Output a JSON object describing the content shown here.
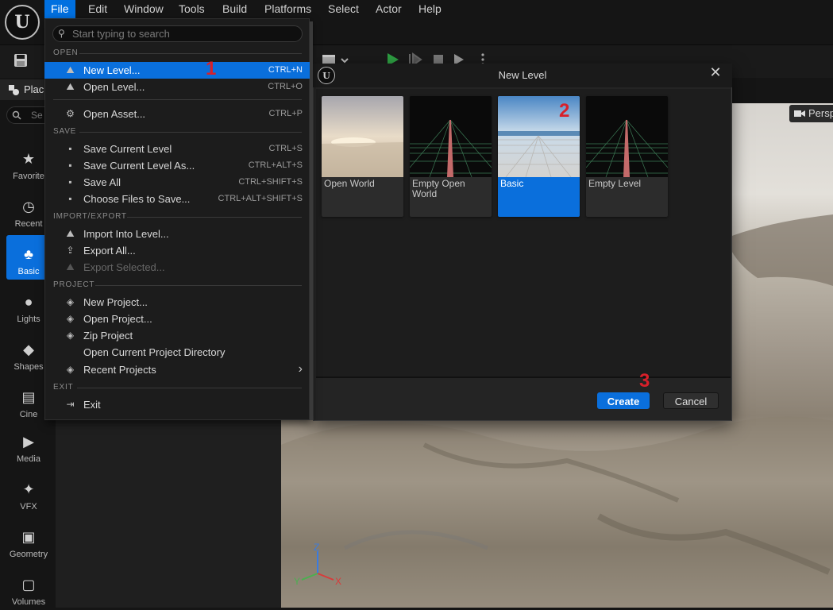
{
  "menubar": {
    "items": [
      "File",
      "Edit",
      "Window",
      "Tools",
      "Build",
      "Platforms",
      "Select",
      "Actor",
      "Help"
    ]
  },
  "place_panel": {
    "tab_label": "Plac",
    "search_placeholder": "Se",
    "modes": [
      {
        "label": "Favorite",
        "icon": "star-icon"
      },
      {
        "label": "Recent",
        "icon": "clock-icon"
      },
      {
        "label": "Basic",
        "icon": "shapes-icon",
        "active": true
      },
      {
        "label": "Lights",
        "icon": "lightbulb-icon"
      },
      {
        "label": "Shapes",
        "icon": "shape-icon"
      },
      {
        "label": "Cine",
        "icon": "clapper-icon"
      },
      {
        "label": "Media",
        "icon": "media-icon"
      },
      {
        "label": "VFX",
        "icon": "sparkle-icon"
      },
      {
        "label": "Geometry",
        "icon": "geometry-icon"
      },
      {
        "label": "Volumes",
        "icon": "volume-icon"
      }
    ]
  },
  "viewport": {
    "perspective_label": "Persp",
    "axis": {
      "z": "Z",
      "y": "Y",
      "x": "X"
    }
  },
  "file_menu": {
    "search_placeholder": "Start typing to search",
    "sections": {
      "open": "OPEN",
      "save": "SAVE",
      "import_export": "IMPORT/EXPORT",
      "project": "PROJECT",
      "exit": "EXIT"
    },
    "items": {
      "new_level": {
        "label": "New Level...",
        "shortcut": "CTRL+N"
      },
      "open_level": {
        "label": "Open Level...",
        "shortcut": "CTRL+O"
      },
      "open_asset": {
        "label": "Open Asset...",
        "shortcut": "CTRL+P"
      },
      "save_current_level": {
        "label": "Save Current Level",
        "shortcut": "CTRL+S"
      },
      "save_current_level_as": {
        "label": "Save Current Level As...",
        "shortcut": "CTRL+ALT+S"
      },
      "save_all": {
        "label": "Save All",
        "shortcut": "CTRL+SHIFT+S"
      },
      "choose_files": {
        "label": "Choose Files to Save...",
        "shortcut": "CTRL+ALT+SHIFT+S"
      },
      "import_into_level": {
        "label": "Import Into Level..."
      },
      "export_all": {
        "label": "Export All..."
      },
      "export_selected": {
        "label": "Export Selected..."
      },
      "new_project": {
        "label": "New Project..."
      },
      "open_project": {
        "label": "Open Project..."
      },
      "zip_project": {
        "label": "Zip Project"
      },
      "open_project_dir": {
        "label": "Open Current Project Directory"
      },
      "recent_projects": {
        "label": "Recent Projects"
      },
      "exit": {
        "label": "Exit"
      }
    }
  },
  "new_level_dialog": {
    "title": "New Level",
    "templates": [
      "Open World",
      "Empty Open World",
      "Basic",
      "Empty Level"
    ],
    "selected": "Basic",
    "create_label": "Create",
    "cancel_label": "Cancel"
  },
  "annotations": {
    "step1": "1",
    "step2": "2",
    "step3": "3"
  },
  "colors": {
    "accent": "#0a6fdc",
    "annotation": "#d8202a"
  }
}
